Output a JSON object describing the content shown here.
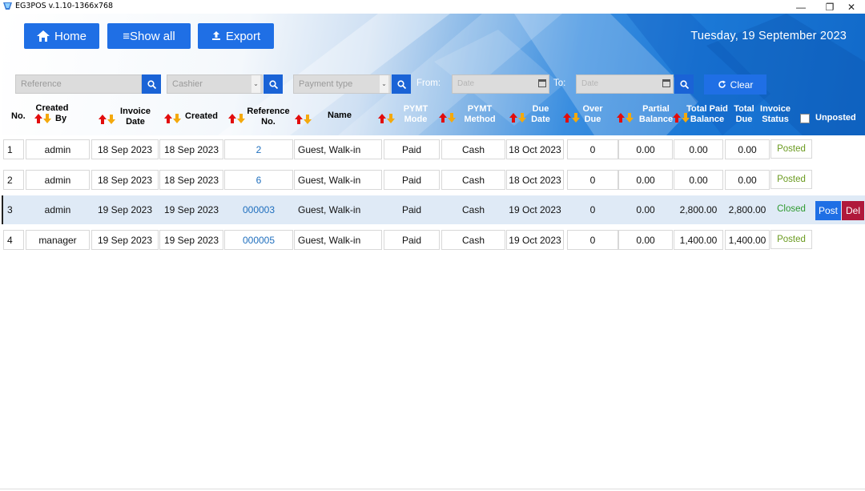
{
  "window": {
    "title": "EG3POS v.1.10-1366x768",
    "minimize": "—",
    "maximize": "❐",
    "close": "✕"
  },
  "toolbar": {
    "home_label": "Home",
    "showall_label": "≡Show all",
    "export_label": "Export"
  },
  "header_date": "Tuesday, 19 September 2023",
  "filters": {
    "reference_placeholder": "Reference",
    "cashier_placeholder": "Cashier",
    "payment_type_placeholder": "Payment type",
    "from_label": "From:",
    "from_value": "Date",
    "to_label": "To:",
    "to_value": "Date",
    "clear_label": "Clear"
  },
  "columns": {
    "no": "No.",
    "created_by_1": "Created",
    "created_by_2": "By",
    "invoice_date_1": "Invoice",
    "invoice_date_2": "Date",
    "created": "Created",
    "ref_1": "Reference",
    "ref_2": "No.",
    "name": "Name",
    "pymt_mode_1": "PYMT",
    "pymt_mode_2": "Mode",
    "pymt_method_1": "PYMT",
    "pymt_method_2": "Method",
    "due_date_1": "Due",
    "due_date_2": "Date",
    "over_due_1": "Over",
    "over_due_2": "Due",
    "partial_1": "Partial",
    "partial_2": "Balance",
    "total_paid_1": "Total Paid",
    "total_paid_2": "Balance",
    "total_due_1": "Total",
    "total_due_2": "Due",
    "invoice_status_1": "Invoice",
    "invoice_status_2": "Status",
    "unposted": "Unposted"
  },
  "rows": [
    {
      "no": "1",
      "created_by": "admin",
      "invoice_date": "18 Sep 2023",
      "created": "18 Sep 2023",
      "ref": "2",
      "name": "Guest, Walk-in",
      "mode": "Paid",
      "method": "Cash",
      "due_date": "18 Oct 2023",
      "over_due": "0",
      "partial": "0.00",
      "total_paid": "0.00",
      "total_due": "0.00",
      "status": "Posted"
    },
    {
      "no": "2",
      "created_by": "admin",
      "invoice_date": "18 Sep 2023",
      "created": "18 Sep 2023",
      "ref": "6",
      "name": "Guest, Walk-in",
      "mode": "Paid",
      "method": "Cash",
      "due_date": "18 Oct 2023",
      "over_due": "0",
      "partial": "0.00",
      "total_paid": "0.00",
      "total_due": "0.00",
      "status": "Posted"
    },
    {
      "no": "3",
      "created_by": "admin",
      "invoice_date": "19 Sep 2023",
      "created": "19 Sep 2023",
      "ref": "000003",
      "name": "Guest, Walk-in",
      "mode": "Paid",
      "method": "Cash",
      "due_date": "19 Oct 2023",
      "over_due": "0",
      "partial": "0.00",
      "total_paid": "2,800.00",
      "total_due": "2,800.00",
      "status": "Closed",
      "post_label": "Post",
      "del_label": "Del"
    },
    {
      "no": "4",
      "created_by": "manager",
      "invoice_date": "19 Sep 2023",
      "created": "19 Sep 2023",
      "ref": "000005",
      "name": "Guest, Walk-in",
      "mode": "Paid",
      "method": "Cash",
      "due_date": "19 Oct 2023",
      "over_due": "0",
      "partial": "0.00",
      "total_paid": "1,400.00",
      "total_due": "1,400.00",
      "status": "Posted"
    }
  ],
  "colors": {
    "accent": "#1f6fe5",
    "posted": "#6a9a1f",
    "closed": "#2f9a2f",
    "delete": "#b0193b",
    "link": "#1f6fbe"
  }
}
